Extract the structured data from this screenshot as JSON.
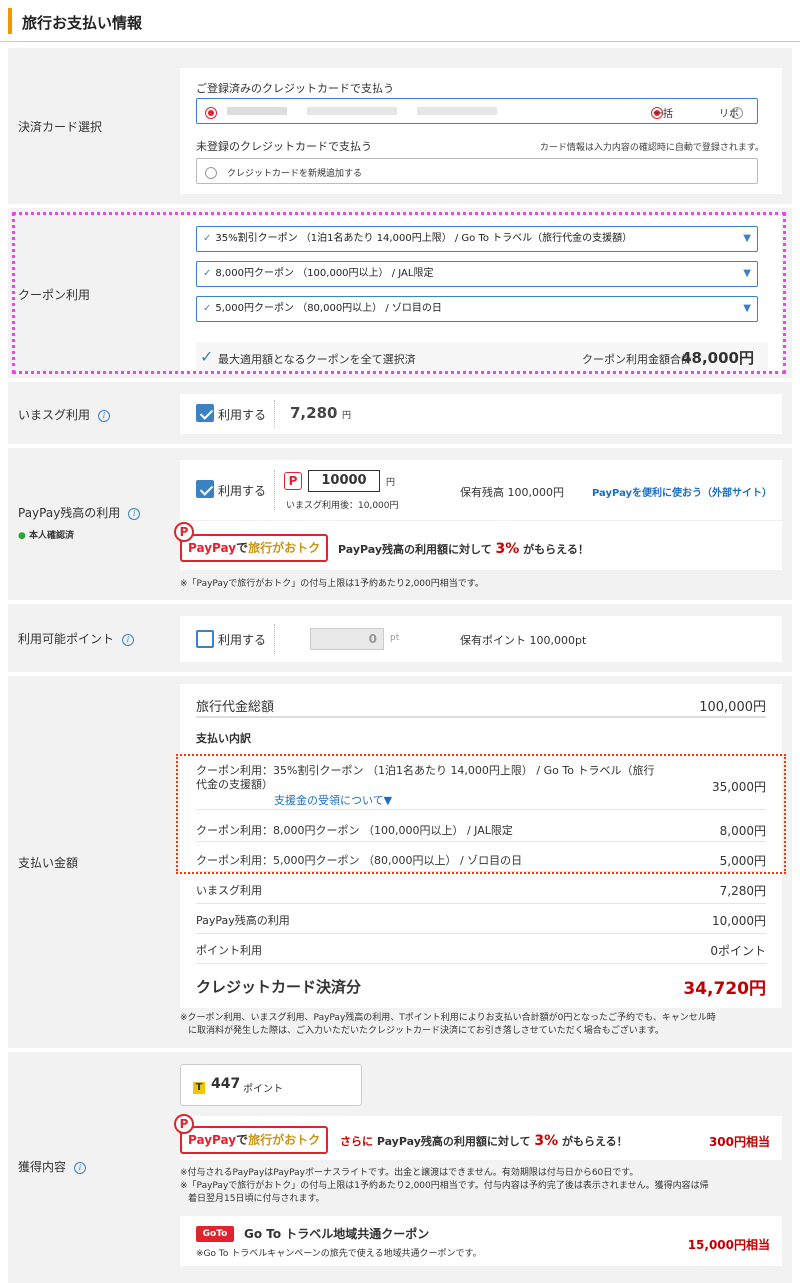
{
  "header": {
    "title": "旅行お支払い情報"
  },
  "card": {
    "label": "決済カード選択",
    "registered_title": "ご登録済みのクレジットカードで支払う",
    "option_lump": "一括",
    "option_revolving": "リボ",
    "unregistered_title": "未登録のクレジットカードで支払う",
    "unregistered_note": "カード情報は入力内容の確認時に自動で登録されます。",
    "add_new": "クレジットカードを新規追加する"
  },
  "coupon": {
    "label": "クーポン利用",
    "selects": [
      "35%割引クーポン （1泊1名あたり 14,000円上限） / Go To トラベル（旅行代金の支援額）",
      "8,000円クーポン （100,000円以上） / JAL限定",
      "5,000円クーポン （80,000円以上） / ゾロ目の日"
    ],
    "all_selected": "最大適用額となるクーポンを全て選択済",
    "total_label": "クーポン利用金額合計",
    "total_value": "48,000円"
  },
  "imasugu": {
    "label": "いまスグ利用",
    "use_label": "利用する",
    "amount": "7,280",
    "unit": "円"
  },
  "paypay": {
    "label": "PayPay残高の利用",
    "verified": "本人確認済",
    "use_label": "利用する",
    "input_value": "10000",
    "unit": "円",
    "after": "いまスグ利用後：10,000円",
    "balance": "保有残高 100,000円",
    "link": "PayPayを便利に使おう（外部サイト）",
    "badge_pp": "PayPay",
    "badge_de": "で",
    "badge_ryo": "旅行がおトク",
    "promo_pre": "PayPay残高の利用額に対して ",
    "promo_pct": "3%",
    "promo_post": " がもらえる！",
    "note": "※「PayPayで旅行がおトク」の付与上限は1予約あたり2,000円相当です。"
  },
  "points": {
    "label": "利用可能ポイント",
    "use_label": "利用する",
    "input_value": "0",
    "unit": "pt",
    "held": "保有ポイント 100,000pt"
  },
  "payment": {
    "label": "支払い金額",
    "total_label": "旅行代金総額",
    "total_value": "100,000円",
    "breakdown_title": "支払い内訳",
    "coupon1_line1": "クーポン利用：35%割引クーポン （1泊1名あたり 14,000円上限） / Go To トラベル（旅行",
    "coupon1_line2": "代金の支援額）",
    "coupon1_value": "35,000円",
    "coupon1_link": "支援金の受領について▼",
    "coupon2_label": "クーポン利用：8,000円クーポン （100,000円以上） / JAL限定",
    "coupon2_value": "8,000円",
    "coupon3_label": "クーポン利用：5,000円クーポン （80,000円以上） / ゾロ目の日",
    "coupon3_value": "5,000円",
    "imasugu_label": "いまスグ利用",
    "imasugu_value": "7,280円",
    "paypay_label": "PayPay残高の利用",
    "paypay_value": "10,000円",
    "point_label": "ポイント利用",
    "point_value": "0ポイント",
    "credit_label": "クレジットカード決済分",
    "credit_value": "34,720円",
    "note_line1": "※クーポン利用、いまスグ利用、PayPay残高の利用、Tポイント利用によりお支払い合計額が0円となったご予約でも、キャンセル時",
    "note_line2": "に取消料が発生した際は、ご入力いただいたクレジットカード決済にてお引き落しさせていただく場合もございます。"
  },
  "earned": {
    "label": "獲得内容",
    "points_value": "447",
    "points_unit": "ポイント",
    "promo_further": "さらに",
    "promo_pre": " PayPay残高の利用額に対して ",
    "promo_pct": "3%",
    "promo_post": " がもらえる！",
    "promo_value": "300円相当",
    "note1": "※付与されるPayPayはPayPayボーナスライトです。出金と譲渡はできません。有効期限は付与日から60日です。",
    "note2_line1": "※「PayPayで旅行がおトク」の付与上限は1予約あたり2,000円相当です。付与内容は予約完了後は表示されません。獲得内容は帰",
    "note2_line2": "着日翌月15日頃に付与されます。",
    "goto_badge": "GoTo",
    "goto_title": "Go To トラベル地域共通クーポン",
    "goto_note": "※Go To トラベルキャンペーンの旅先で使える地域共通クーポンです。",
    "goto_value": "15,000円相当"
  },
  "colors": {
    "accent": "#f39700",
    "link": "#1a6fc4",
    "magenta_highlight": "#ee44ee",
    "red_highlight": "#ff3300",
    "price_red": "#c00000"
  }
}
